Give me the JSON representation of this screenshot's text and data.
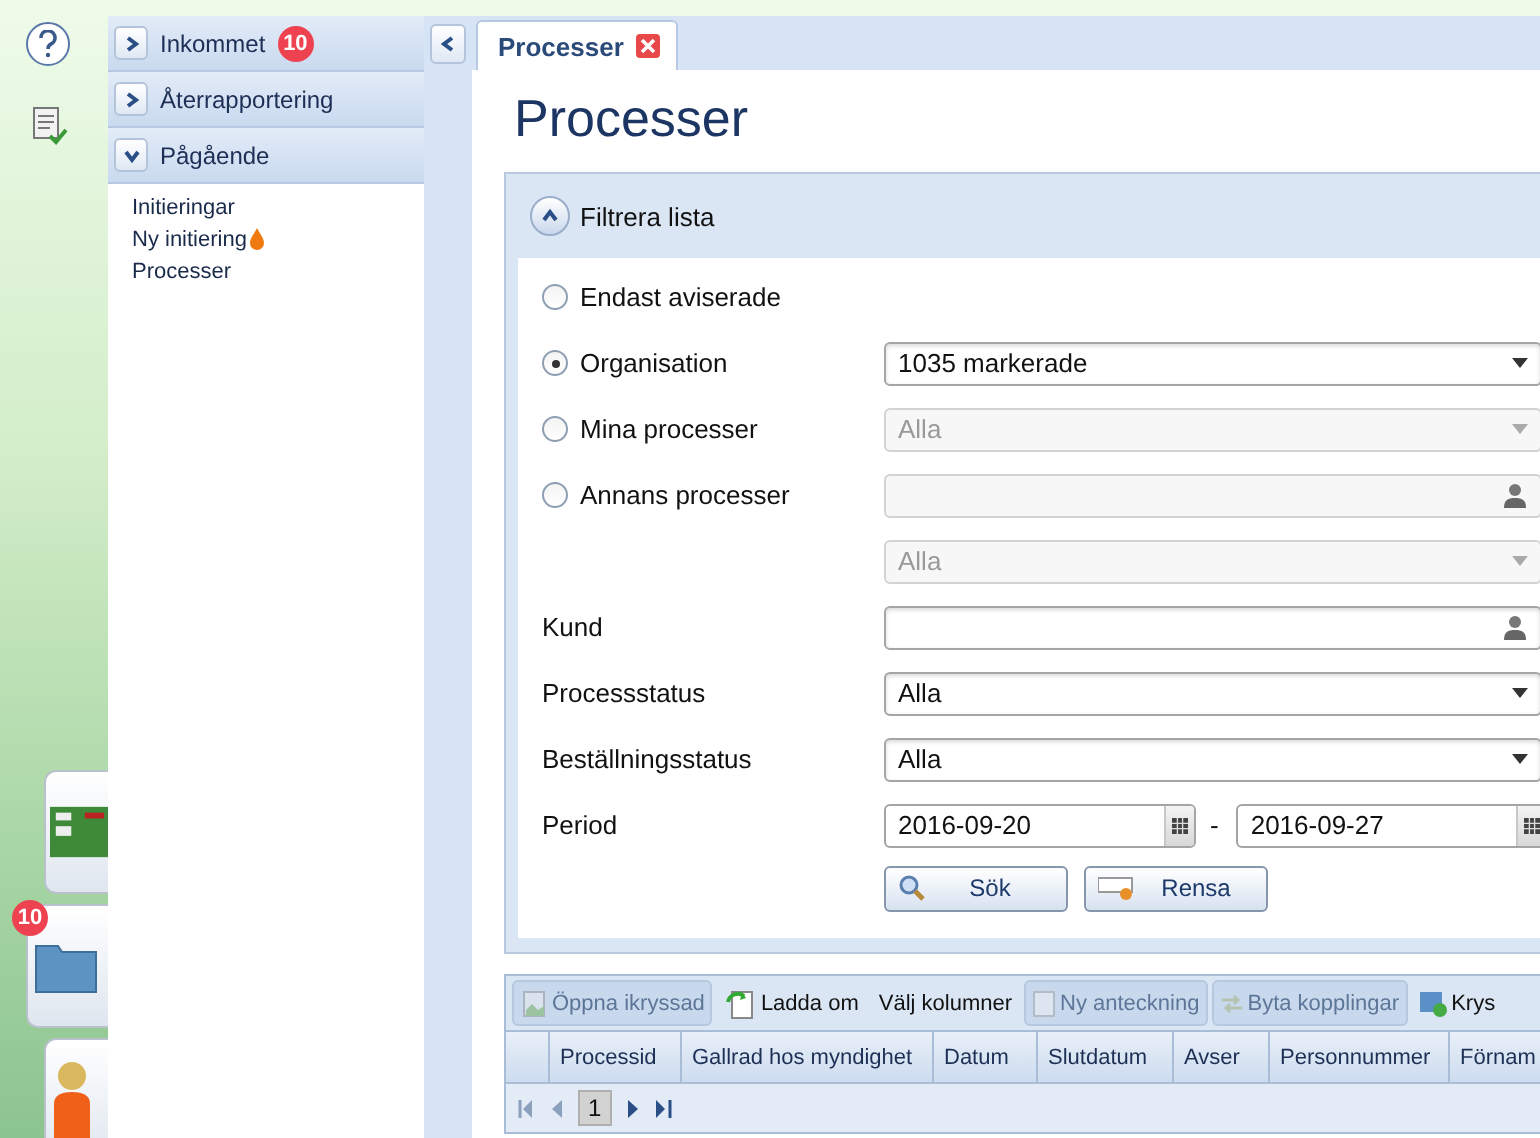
{
  "rail": {
    "tiles": [
      {
        "kind": "board"
      },
      {
        "kind": "folder",
        "badge": "10"
      },
      {
        "kind": "person"
      }
    ]
  },
  "nav": {
    "sections": [
      {
        "label": "Inkommet",
        "expanded": false,
        "badge": "10"
      },
      {
        "label": "Återrapportering",
        "expanded": false
      },
      {
        "label": "Pågående",
        "expanded": true,
        "items": [
          {
            "label": "Initieringar"
          },
          {
            "label": "Ny initiering",
            "flame": true
          },
          {
            "label": "Processer"
          }
        ]
      }
    ]
  },
  "tabs": [
    {
      "label": "Processer",
      "selected": true
    }
  ],
  "page_title": "Processer",
  "filter": {
    "title": "Filtrera lista",
    "expanded": true,
    "rows": [
      {
        "kind": "radio",
        "label": "Endast aviserade",
        "selected": false
      },
      {
        "kind": "radio",
        "label": "Organisation",
        "selected": true,
        "field": {
          "kind": "dropdown",
          "value": "1035 markerade",
          "disabled": false
        }
      },
      {
        "kind": "radio",
        "label": "Mina processer",
        "selected": false,
        "field": {
          "kind": "dropdown",
          "value": "Alla",
          "disabled": true
        }
      },
      {
        "kind": "radio",
        "label": "Annans processer",
        "selected": false,
        "field": {
          "kind": "lookup",
          "disabled": true
        }
      },
      {
        "kind": "blank",
        "field": {
          "kind": "dropdown",
          "value": "Alla",
          "disabled": true
        }
      },
      {
        "kind": "label",
        "label": "Kund",
        "field": {
          "kind": "lookup",
          "disabled": false
        }
      },
      {
        "kind": "label",
        "label": "Processstatus",
        "field": {
          "kind": "dropdown",
          "value": "Alla",
          "disabled": false
        }
      },
      {
        "kind": "label",
        "label": "Beställningsstatus",
        "field": {
          "kind": "dropdown",
          "value": "Alla",
          "disabled": false
        }
      },
      {
        "kind": "period",
        "label": "Period",
        "from": "2016-09-20",
        "separator": "-",
        "to": "2016-09-27"
      }
    ],
    "buttons": [
      {
        "kind": "search",
        "label": "Sök"
      },
      {
        "kind": "clear",
        "label": "Rensa"
      }
    ]
  },
  "toolbar": [
    {
      "kind": "open",
      "label": "Öppna ikryssad",
      "disabled": true
    },
    {
      "kind": "reload",
      "label": "Ladda om",
      "disabled": false
    },
    {
      "kind": "plain",
      "label": "Välj kolumner",
      "disabled": false
    },
    {
      "kind": "note",
      "label": "Ny anteckning",
      "disabled": true
    },
    {
      "kind": "swap",
      "label": "Byta kopplingar",
      "disabled": true
    },
    {
      "kind": "add",
      "label": "Krys",
      "disabled": false
    }
  ],
  "table": {
    "columns": [
      "Processid",
      "Gallrad hos myndighet",
      "Datum",
      "Slutdatum",
      "Avser",
      "Personnummer",
      "Förnam"
    ]
  },
  "pager": {
    "page": "1"
  }
}
